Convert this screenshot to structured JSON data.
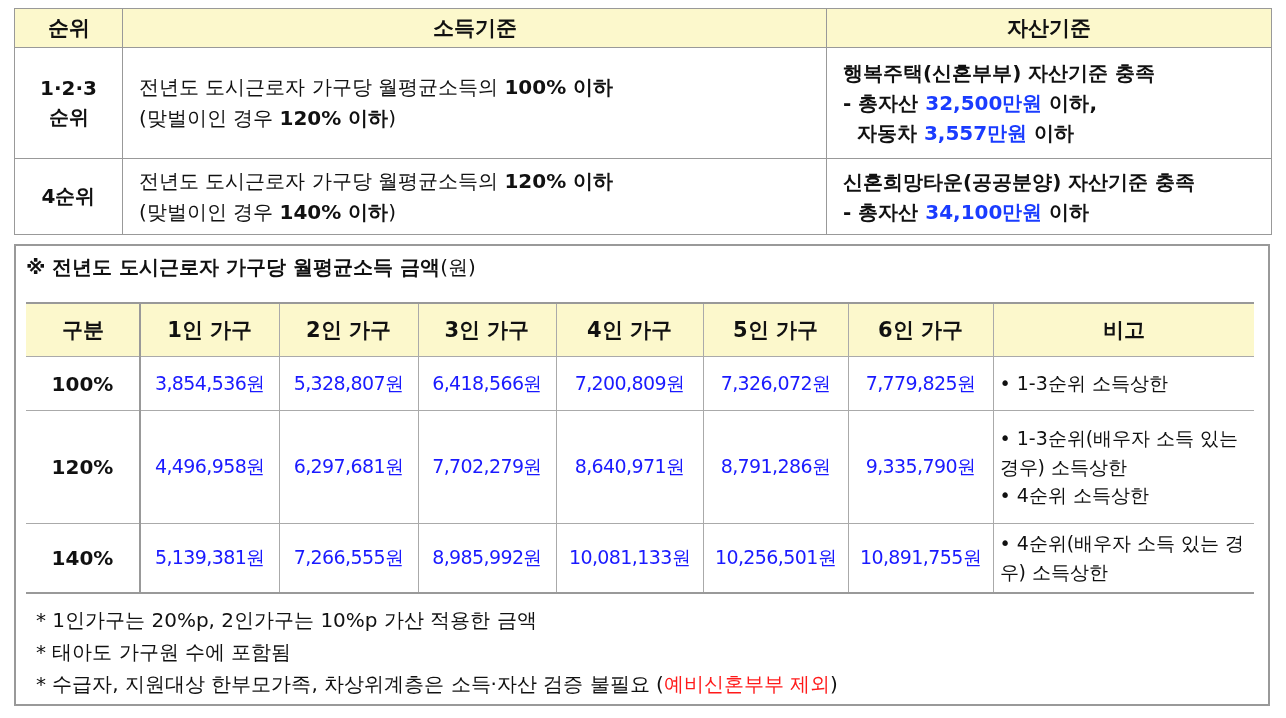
{
  "criteria_table": {
    "columns": [
      "순위",
      "소득기준",
      "자산기준"
    ],
    "rows": [
      {
        "rank": "1·2·3\n순위",
        "income": [
          "전년도 도시근로자 가구당 월평균소득의 **100% 이하**",
          "(맞벌이인 경우 **120% 이하**)"
        ],
        "asset_title": "행복주택(신혼부부) 자산기준 충족",
        "asset_lines": [
          [
            {
              "text": "- 총자산 ",
              "kind": "plain"
            },
            {
              "text": "32,500만원",
              "kind": "highlight"
            },
            {
              "text": " 이하,",
              "kind": "plain"
            }
          ],
          [
            {
              "text": "  자동차 ",
              "kind": "plain"
            },
            {
              "text": "3,557만원",
              "kind": "highlight"
            },
            {
              "text": " 이하",
              "kind": "plain"
            }
          ]
        ]
      },
      {
        "rank": "4순위",
        "income": [
          "전년도 도시근로자 가구당 월평균소득의 **120% 이하**",
          "(맞벌이인 경우 **140% 이하**)"
        ],
        "asset_title": "신혼희망타운(공공분양) 자산기준 충족",
        "asset_lines": [
          [
            {
              "text": "- 총자산 ",
              "kind": "plain"
            },
            {
              "text": "34,100만원",
              "kind": "highlight"
            },
            {
              "text": " 이하",
              "kind": "plain"
            }
          ]
        ]
      }
    ]
  },
  "income_box": {
    "title": "**※ 전년도 도시근로자 가구당 월평균소득 금액**(원)",
    "columns": [
      "구분",
      "1인 가구",
      "2인 가구",
      "3인 가구",
      "4인 가구",
      "5인 가구",
      "6인 가구",
      "비고"
    ],
    "rows": [
      {
        "label": "100%",
        "values": [
          "3,854,536원",
          "5,328,807원",
          "6,418,566원",
          "7,200,809원",
          "7,326,072원",
          "7,779,825원"
        ],
        "notes": [
          "• 1-3순위 소득상한"
        ]
      },
      {
        "label": "120%",
        "values": [
          "4,496,958원",
          "6,297,681원",
          "7,702,279원",
          "8,640,971원",
          "8,791,286원",
          "9,335,790원"
        ],
        "notes": [
          "• 1-3순위(배우자 소득 있는 경우) 소득상한",
          "• 4순위 소득상한"
        ]
      },
      {
        "label": "140%",
        "values": [
          "5,139,381원",
          "7,266,555원",
          "8,985,992원",
          "10,081,133원",
          "10,256,501원",
          "10,891,755원"
        ],
        "notes": [
          "• 4순위(배우자 소득 있는 경우) 소득상한"
        ]
      }
    ],
    "footnotes": [
      [
        {
          "text": "* 1인가구는 20%p, 2인가구는 10%p 가산 적용한 금액",
          "kind": "plain"
        }
      ],
      [
        {
          "text": "* 태아도 가구원 수에 포함됨",
          "kind": "plain"
        }
      ],
      [
        {
          "text": "* 수급자, 지원대상 한부모가족, 차상위계층은 소득·자산 검증 불필요 (",
          "kind": "plain"
        },
        {
          "text": "예비신혼부부 제외",
          "kind": "warning"
        },
        {
          "text": ")",
          "kind": "plain"
        }
      ]
    ]
  }
}
